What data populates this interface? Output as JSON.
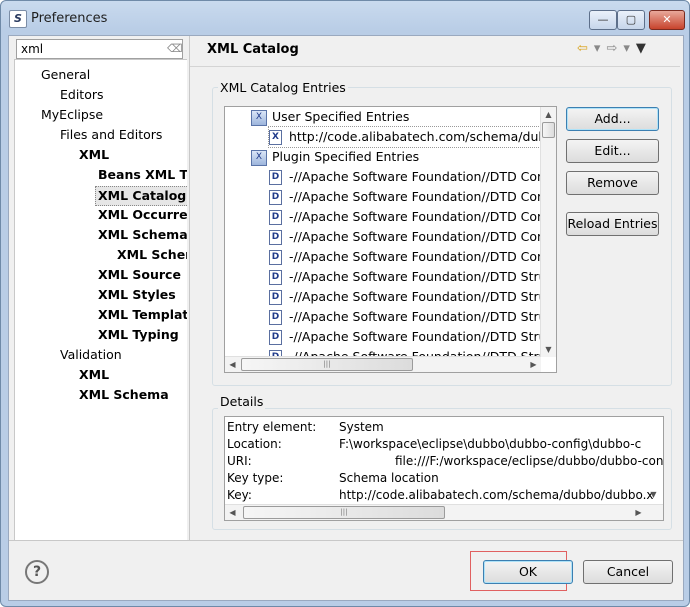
{
  "window": {
    "title": "Preferences",
    "minimize_glyph": "—",
    "maximize_glyph": "▢",
    "close_glyph": "✕"
  },
  "filter": {
    "value": "xml"
  },
  "nav_tree": [
    {
      "label": "General",
      "bold": false,
      "selected": false
    },
    {
      "label": "Editors",
      "bold": false,
      "selected": false
    },
    {
      "label": "MyEclipse",
      "bold": false,
      "selected": false
    },
    {
      "label": "Files and Editors",
      "bold": false,
      "selected": false
    },
    {
      "label": "XML",
      "bold": true,
      "selected": false
    },
    {
      "label": "Beans XML Te",
      "bold": true,
      "selected": false
    },
    {
      "label": "XML Catalog",
      "bold": true,
      "selected": true
    },
    {
      "label": "XML Occurren",
      "bold": true,
      "selected": false
    },
    {
      "label": "XML Schema",
      "bold": true,
      "selected": false
    },
    {
      "label": "XML Schen",
      "bold": true,
      "selected": false
    },
    {
      "label": "XML Source",
      "bold": true,
      "selected": false
    },
    {
      "label": "XML Styles",
      "bold": true,
      "selected": false
    },
    {
      "label": "XML Template",
      "bold": true,
      "selected": false
    },
    {
      "label": "XML Typing",
      "bold": true,
      "selected": false
    },
    {
      "label": "Validation",
      "bold": false,
      "selected": false
    },
    {
      "label": "XML",
      "bold": true,
      "selected": false
    },
    {
      "label": "XML Schema",
      "bold": true,
      "selected": false
    }
  ],
  "page": {
    "title": "XML Catalog",
    "entries_group_label": "XML Catalog Entries",
    "details_group_label": "Details"
  },
  "catalog": {
    "user_specified": "User Specified Entries",
    "user_entry": "http://code.alibabatech.com/schema/dubb",
    "plugin_specified": "Plugin Specified Entries",
    "plugin_entries": [
      "-//Apache Software Foundation//DTD Com",
      "-//Apache Software Foundation//DTD Com",
      "-//Apache Software Foundation//DTD Com",
      "-//Apache Software Foundation//DTD Com",
      "-//Apache Software Foundation//DTD Com",
      "-//Apache Software Foundation//DTD Strut",
      "-//Apache Software Foundation//DTD Strut",
      "-//Apache Software Foundation//DTD Strut",
      "-//Apache Software Foundation//DTD Strut",
      "-//Apache Software Foundation//DTD Strut"
    ]
  },
  "buttons": {
    "add": "Add...",
    "edit": "Edit...",
    "remove": "Remove",
    "reload": "Reload Entries",
    "ok": "OK",
    "cancel": "Cancel"
  },
  "details": [
    {
      "key": "Entry element:",
      "value": "System"
    },
    {
      "key": "Location:",
      "value": "F:\\workspace\\eclipse\\dubbo\\dubbo-config\\dubbo-c"
    },
    {
      "key": "URI:",
      "value": "file:///F:/workspace/eclipse/dubbo/dubbo-confi"
    },
    {
      "key": "Key type:",
      "value": "Schema location"
    },
    {
      "key": "Key:",
      "value": "http://code.alibabatech.com/schema/dubbo/dubbo.x"
    }
  ],
  "glyphs": {
    "help": "?",
    "doc_icon": "D",
    "xsd_icon": "X",
    "folder_icon": "X",
    "nav_back": "⇦",
    "nav_forward": "⇨",
    "dropdown": "▾",
    "menu": "▼",
    "grip": "|||",
    "arrow_up": "▲",
    "arrow_down": "▼",
    "arrow_left": "◀",
    "arrow_right": "▶",
    "clear_filter": "⌫"
  }
}
